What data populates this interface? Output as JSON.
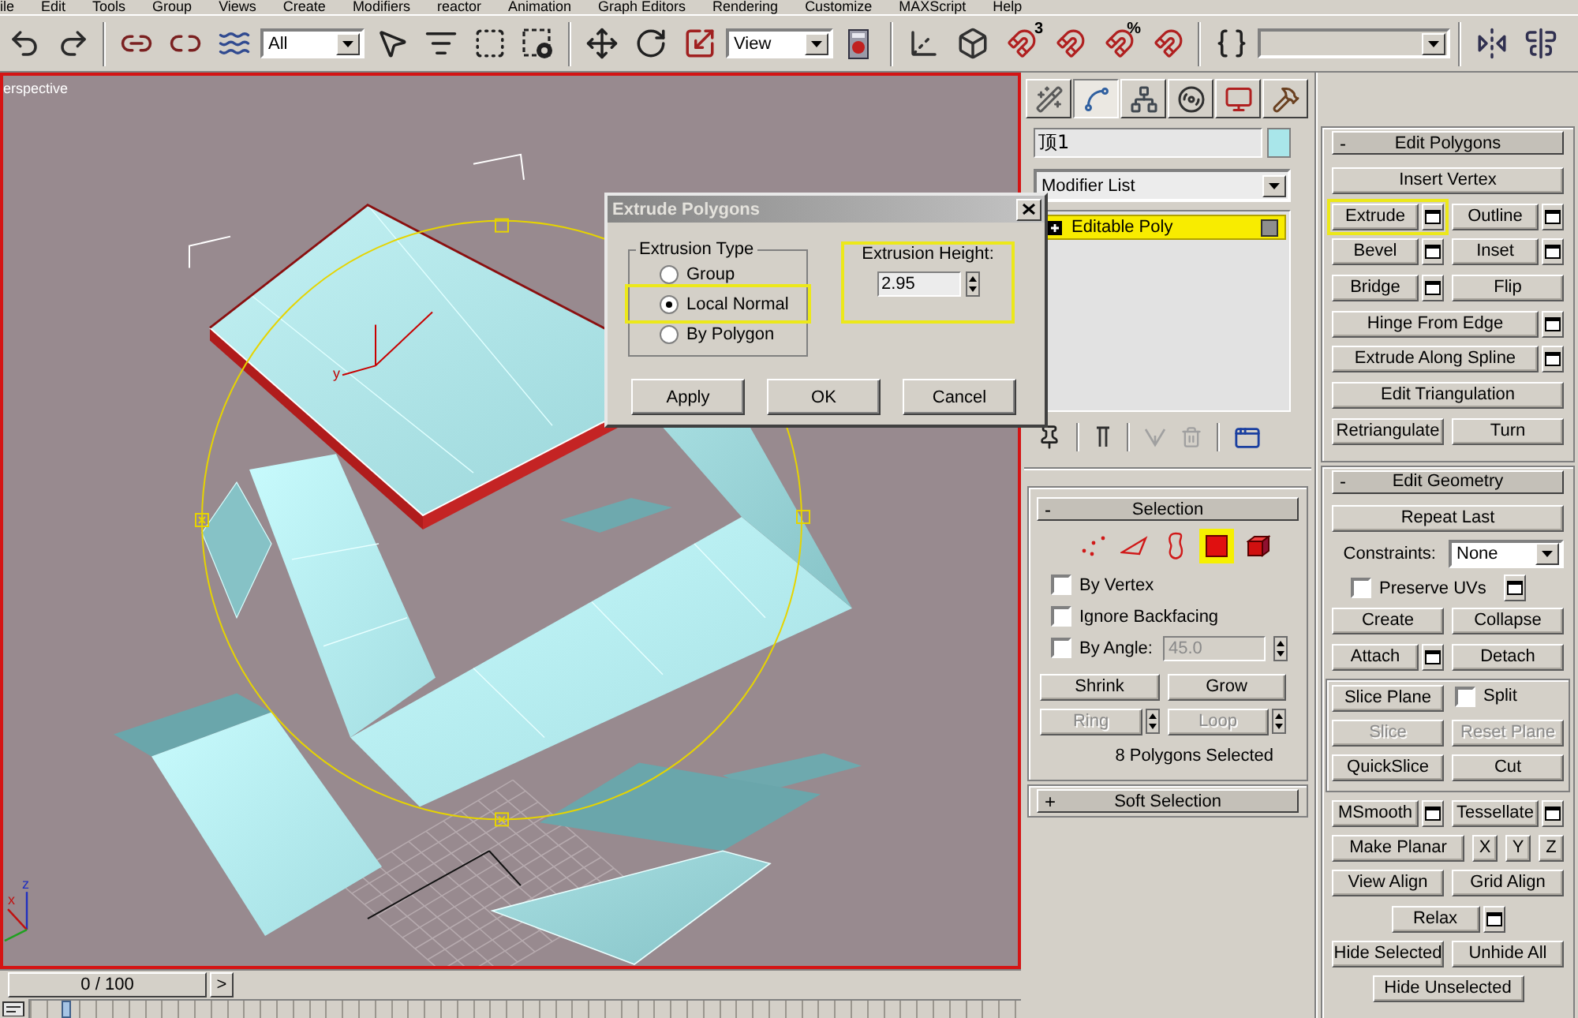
{
  "menu_bar": {
    "items": [
      "ile",
      "Edit",
      "Tools",
      "Group",
      "Views",
      "Create",
      "Modifiers",
      "reactor",
      "Animation",
      "Graph Editors",
      "Rendering",
      "Customize",
      "MAXScript",
      "Help"
    ]
  },
  "main_toolbar": {
    "selection_filter": "All",
    "reference_coordinate_system": "View",
    "snap_label": "3",
    "percent_snap_label": "%"
  },
  "viewport": {
    "label": "erspective",
    "active": true,
    "gizmo_axis_label": "y",
    "tripod_labels": [
      "x",
      "z"
    ]
  },
  "dialog": {
    "title": "Extrude Polygons",
    "group_label": "Extrusion Type",
    "options": [
      {
        "label": "Group",
        "selected": false,
        "highlighted": false
      },
      {
        "label": "Local Normal",
        "selected": true,
        "highlighted": true
      },
      {
        "label": "By Polygon",
        "selected": false,
        "highlighted": false
      }
    ],
    "height_label": "Extrusion Height:",
    "height_value": "2.95",
    "height_highlighted": true,
    "buttons": [
      "Apply",
      "OK",
      "Cancel"
    ]
  },
  "command_panel": {
    "tabs": [
      {
        "selected": false
      },
      {
        "selected": true
      },
      {
        "selected": false
      },
      {
        "selected": false
      },
      {
        "selected": false
      },
      {
        "selected": false
      }
    ],
    "object_name": "顶1",
    "modifier_list": "Modifier List",
    "stack": [
      {
        "label": "Editable Poly",
        "selected": true,
        "expanded": false
      }
    ],
    "selection": {
      "toggle": "-",
      "title": "Selection",
      "levels": [
        {
          "selected": false
        },
        {
          "selected": false
        },
        {
          "selected": false
        },
        {
          "selected": true
        },
        {
          "selected": false
        }
      ],
      "options": [
        {
          "kind": "checkbox",
          "label": "By Vertex",
          "checked": false
        },
        {
          "kind": "checkbox",
          "label": "Ignore Backfacing",
          "checked": false
        },
        {
          "kind": "checkbox_field",
          "label": "By Angle:",
          "checked": false,
          "value": "45.0"
        }
      ],
      "buttons": [
        {
          "label": "Shrink",
          "disabled": false,
          "spinner": false
        },
        {
          "label": "Grow",
          "disabled": false,
          "spinner": false
        },
        {
          "label": "Ring",
          "disabled": true,
          "spinner": true
        },
        {
          "label": "Loop",
          "disabled": true,
          "spinner": true
        }
      ],
      "status": "8 Polygons Selected"
    },
    "soft_selection": {
      "toggle": "+",
      "title": "Soft Selection"
    },
    "edit_polygons": {
      "toggle": "-",
      "title": "Edit Polygons",
      "rows": [
        {
          "buttons": [
            {
              "label": "Insert Vertex",
              "settings": false,
              "highlighted": false
            }
          ]
        },
        {
          "buttons": [
            {
              "label": "Extrude",
              "settings": true,
              "highlighted": true
            },
            {
              "label": "Outline",
              "settings": true,
              "highlighted": false
            }
          ]
        },
        {
          "buttons": [
            {
              "label": "Bevel",
              "settings": true,
              "highlighted": false
            },
            {
              "label": "Inset",
              "settings": true,
              "highlighted": false
            }
          ]
        },
        {
          "buttons": [
            {
              "label": "Bridge",
              "settings": true,
              "highlighted": false
            },
            {
              "label": "Flip",
              "settings": false,
              "highlighted": false
            }
          ]
        },
        {
          "buttons": [
            {
              "label": "Hinge From Edge",
              "settings": true,
              "highlighted": false
            }
          ]
        },
        {
          "buttons": [
            {
              "label": "Extrude Along Spline",
              "settings": true,
              "highlighted": false
            }
          ]
        },
        {
          "buttons": [
            {
              "label": "Edit Triangulation",
              "settings": false,
              "highlighted": false
            }
          ]
        },
        {
          "buttons": [
            {
              "label": "Retriangulate",
              "settings": false,
              "highlighted": false
            },
            {
              "label": "Turn",
              "settings": false,
              "highlighted": false
            }
          ]
        }
      ]
    },
    "edit_geometry": {
      "toggle": "-",
      "title": "Edit Geometry",
      "rows": [
        {
          "kind": "buttons",
          "buttons": [
            {
              "label": "Repeat Last",
              "settings": false,
              "disabled": false
            }
          ]
        },
        {
          "kind": "dropdown",
          "label": "Constraints:",
          "value": "None"
        },
        {
          "kind": "checkbox",
          "label": "Preserve UVs",
          "checked": false,
          "settings": true
        },
        {
          "kind": "buttons",
          "buttons": [
            {
              "label": "Create",
              "settings": false,
              "disabled": false
            },
            {
              "label": "Collapse",
              "settings": false,
              "disabled": false
            }
          ]
        },
        {
          "kind": "buttons",
          "buttons": [
            {
              "label": "Attach",
              "settings": true,
              "disabled": false
            },
            {
              "label": "Detach",
              "settings": false,
              "disabled": false
            }
          ]
        },
        {
          "kind": "group",
          "rows": [
            {
              "kind": "button_checkbox",
              "button": {
                "label": "Slice Plane",
                "settings": false,
                "disabled": false
              },
              "checkbox": {
                "label": "Split",
                "checked": false
              }
            },
            {
              "kind": "buttons",
              "buttons": [
                {
                  "label": "Slice",
                  "settings": false,
                  "disabled": true
                },
                {
                  "label": "Reset Plane",
                  "settings": false,
                  "disabled": true
                }
              ]
            },
            {
              "kind": "buttons",
              "buttons": [
                {
                  "label": "QuickSlice",
                  "settings": false,
                  "disabled": false
                },
                {
                  "label": "Cut",
                  "settings": false,
                  "disabled": false
                }
              ]
            }
          ]
        },
        {
          "kind": "buttons",
          "buttons": [
            {
              "label": "MSmooth",
              "settings": true,
              "disabled": false
            },
            {
              "label": "Tessellate",
              "settings": true,
              "disabled": false
            }
          ]
        },
        {
          "kind": "axis_buttons",
          "button": {
            "label": "Make Planar",
            "settings": false,
            "disabled": false
          },
          "axes": [
            "X",
            "Y",
            "Z"
          ]
        },
        {
          "kind": "buttons",
          "buttons": [
            {
              "label": "View Align",
              "settings": false,
              "disabled": false
            },
            {
              "label": "Grid Align",
              "settings": false,
              "disabled": false
            }
          ]
        },
        {
          "kind": "centered",
          "buttons": [
            {
              "label": "Relax",
              "settings": true,
              "disabled": false
            }
          ]
        },
        {
          "kind": "buttons",
          "buttons": [
            {
              "label": "Hide Selected",
              "settings": false,
              "disabled": false
            },
            {
              "label": "Unhide All",
              "settings": false,
              "disabled": false
            }
          ]
        },
        {
          "kind": "centered",
          "buttons": [
            {
              "label": "Hide Unselected",
              "settings": false,
              "disabled": false
            }
          ]
        }
      ]
    }
  },
  "time_slider": {
    "label": "0 / 100",
    "level": 0,
    "next_label": ">"
  }
}
